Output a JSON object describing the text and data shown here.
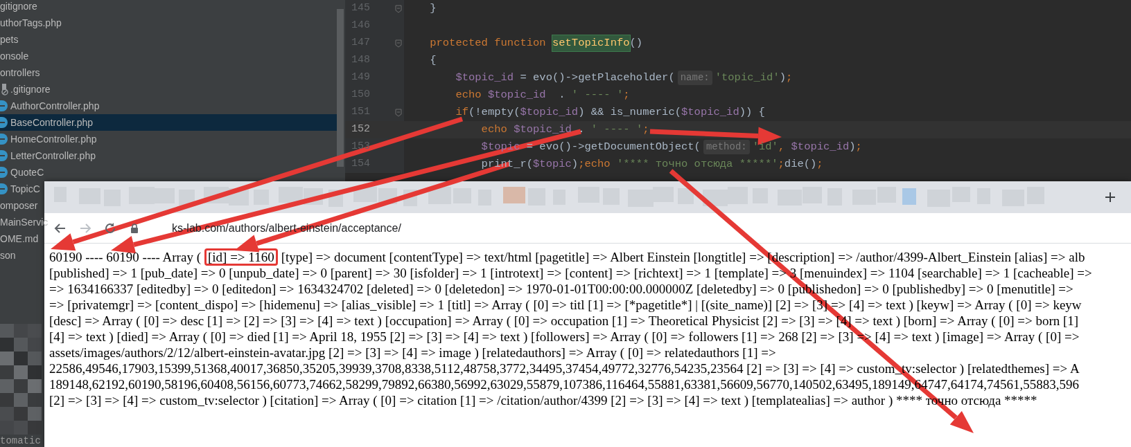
{
  "project_tree": {
    "items": [
      {
        "label": "gitignore",
        "kind": "plain",
        "selected": false
      },
      {
        "label": "uthorTags.php",
        "kind": "plain",
        "selected": false
      },
      {
        "label": "pets",
        "kind": "plain",
        "selected": false
      },
      {
        "label": "onsole",
        "kind": "plain",
        "selected": false
      },
      {
        "label": "ontrollers",
        "kind": "plain",
        "selected": false
      },
      {
        "label": ".gitignore",
        "kind": "ignore",
        "selected": false
      },
      {
        "label": "AuthorController.php",
        "kind": "class",
        "selected": false
      },
      {
        "label": "BaseController.php",
        "kind": "class",
        "selected": true
      },
      {
        "label": "HomeController.php",
        "kind": "class",
        "selected": false
      },
      {
        "label": "LetterController.php",
        "kind": "class",
        "selected": false
      },
      {
        "label": "QuoteC",
        "kind": "class",
        "selected": false
      },
      {
        "label": "TopicC",
        "kind": "class",
        "selected": false
      },
      {
        "label": "omposer",
        "kind": "plain",
        "selected": false
      },
      {
        "label": "MainServic",
        "kind": "plain",
        "selected": false
      },
      {
        "label": "OME.md",
        "kind": "plain",
        "selected": false
      },
      {
        "label": "son",
        "kind": "plain",
        "selected": false
      }
    ]
  },
  "editor": {
    "lines": [
      {
        "number": "145",
        "current": false,
        "fold_mark": true,
        "tokens": [
          {
            "kind": "plain",
            "text": "    }"
          }
        ]
      },
      {
        "number": "146",
        "current": false,
        "fold_mark": false
      },
      {
        "number": "147",
        "current": false,
        "fold_mark": true,
        "tokens": [
          {
            "kind": "keyword",
            "text": "    protected function "
          },
          {
            "kind": "match",
            "text": "setTopicInfo"
          },
          {
            "kind": "plain",
            "text": "()"
          }
        ]
      },
      {
        "number": "148",
        "current": false,
        "fold_mark": false,
        "tokens": [
          {
            "kind": "plain",
            "text": "    {"
          }
        ]
      },
      {
        "number": "149",
        "current": false,
        "fold_mark": false,
        "tokens": [
          {
            "kind": "variable",
            "text": "        $topic_id"
          },
          {
            "kind": "plain",
            "text": " = evo()->getPlaceholder("
          },
          {
            "kind": "hint",
            "text": "name:"
          },
          {
            "kind": "string",
            "text": "'topic_id'"
          },
          {
            "kind": "plain",
            "text": ")"
          },
          {
            "kind": "keyword",
            "text": ";"
          }
        ]
      },
      {
        "number": "150",
        "current": false,
        "fold_mark": false,
        "tokens": [
          {
            "kind": "keyword",
            "text": "        echo "
          },
          {
            "kind": "variable",
            "text": "$topic_id"
          },
          {
            "kind": "plain",
            "text": "  . "
          },
          {
            "kind": "string",
            "text": "' ---- '"
          },
          {
            "kind": "keyword",
            "text": ";"
          }
        ]
      },
      {
        "number": "151",
        "current": false,
        "fold_mark": true,
        "tokens": [
          {
            "kind": "keyword",
            "text": "        if"
          },
          {
            "kind": "plain",
            "text": "(!empty("
          },
          {
            "kind": "variable",
            "text": "$topic_id"
          },
          {
            "kind": "plain",
            "text": ") && is_numeric("
          },
          {
            "kind": "variable",
            "text": "$topic_id"
          },
          {
            "kind": "plain",
            "text": ")) {"
          }
        ]
      },
      {
        "number": "152",
        "current": true,
        "fold_mark": false,
        "tokens": [
          {
            "kind": "keyword",
            "text": "            echo "
          },
          {
            "kind": "variable",
            "text": "$topic_id"
          },
          {
            "kind": "plain",
            "text": " . "
          },
          {
            "kind": "string",
            "text": "' ---- '"
          },
          {
            "kind": "keyword",
            "text": ";"
          }
        ]
      },
      {
        "number": "153",
        "current": false,
        "fold_mark": false,
        "tokens": [
          {
            "kind": "variable",
            "text": "            $topic"
          },
          {
            "kind": "plain",
            "text": " = evo()->getDocumentObject("
          },
          {
            "kind": "hint",
            "text": "method:"
          },
          {
            "kind": "string",
            "text": "'id'"
          },
          {
            "kind": "keyword",
            "text": ", "
          },
          {
            "kind": "variable",
            "text": "$topic_id"
          },
          {
            "kind": "plain",
            "text": ")"
          },
          {
            "kind": "keyword",
            "text": ";"
          }
        ]
      },
      {
        "number": "154",
        "current": false,
        "fold_mark": false,
        "tokens": [
          {
            "kind": "plain",
            "text": "            print_r("
          },
          {
            "kind": "variable",
            "text": "$topic"
          },
          {
            "kind": "plain",
            "text": ")"
          },
          {
            "kind": "keyword",
            "text": ";echo "
          },
          {
            "kind": "string",
            "text": "'**** точно отсюда *****'"
          },
          {
            "kind": "keyword",
            "text": ";"
          },
          {
            "kind": "plain",
            "text": "die()"
          },
          {
            "kind": "keyword",
            "text": ";"
          }
        ]
      }
    ]
  },
  "ide_footer": {
    "text": "tomatic"
  },
  "browser": {
    "address": "ks-lab.com/authors/albert-einstein/acceptance/",
    "content_lines": [
      {
        "segments": [
          {
            "text": "60190 ---- 60190 ---- Array (",
            "boxed": false
          },
          {
            "text": "[id] => 1160",
            "boxed": true
          },
          {
            "text": "[type] => document [contentType] => text/html [pagetitle] => Albert Einstein [longtitle] => [description] => /author/4399-Albert_Einstein [alias] => alb",
            "boxed": false
          }
        ]
      },
      {
        "segments": [
          {
            "text": "[published] => 1 [pub_date] => 0 [unpub_date] => 0 [parent] => 30 [isfolder] => 1 [introtext] => [content] => [richtext] => 1 [template] => 3 [menuindex] => 1104 [searchable] => 1 [cacheable] =>",
            "boxed": false
          }
        ]
      },
      {
        "segments": [
          {
            "text": "=> 1634166337 [editedby] => 0 [editedon] => 1634324702 [deleted] => 0 [deletedon] => 1970-01-01T00:00:00.000000Z [deletedby] => 0 [publishedon] => 0 [publishedby] => 0 [menutitle] =>",
            "boxed": false
          }
        ]
      },
      {
        "segments": [
          {
            "text": "=> [privatemgr] => [content_dispo] => [hidemenu] => [alias_visible] => 1 [titl] => Array ( [0] => titl [1] => [*pagetitle*] | [(site_name)] [2] => [3] => [4] => text ) [keyw] => Array ( [0] => keyw",
            "boxed": false
          }
        ]
      },
      {
        "segments": [
          {
            "text": "[desc] => Array ( [0] => desc [1] => [2] => [3] => [4] => text ) [occupation] => Array ( [0] => occupation [1] => Theoretical Physicist [2] => [3] => [4] => text ) [born] => Array ( [0] => born [1]",
            "boxed": false
          }
        ]
      },
      {
        "segments": [
          {
            "text": "[4] => text ) [died] => Array ( [0] => died [1] => April 18, 1955 [2] => [3] => [4] => text ) [followers] => Array ( [0] => followers [1] => 268 [2] => [3] => [4] => text ) [image] => Array ( [0] =>",
            "boxed": false
          }
        ]
      },
      {
        "segments": [
          {
            "text": "assets/images/authors/2/12/albert-einstein-avatar.jpg [2] => [3] => [4] => image ) [relatedauthors] => Array ( [0] => relatedauthors [1] =>",
            "boxed": false
          }
        ]
      },
      {
        "segments": [
          {
            "text": "22586,49546,17903,15399,51368,40017,36850,35205,39939,3708,8338,5112,48758,3772,34495,37454,49772,32776,54235,23564 [2] => [3] => [4] => custom_tv:selector ) [relatedthemes] => A",
            "boxed": false
          }
        ]
      },
      {
        "segments": [
          {
            "text": "189148,62192,60190,58196,60408,56156,60773,74662,58299,79892,66380,56992,63029,55879,107386,116464,55881,63381,56609,56770,140502,63495,189149,64747,64174,74561,55883,596",
            "boxed": false
          }
        ]
      },
      {
        "segments": [
          {
            "text": "[2] => [3] => [4] => custom_tv:selector ) [citation] => Array ( [0] => citation [1] => /citation/author/4399 [2] => [3] => [4] => text ) [templatealias] => author ) **** точно отсюда *****",
            "boxed": false
          }
        ]
      }
    ]
  }
}
